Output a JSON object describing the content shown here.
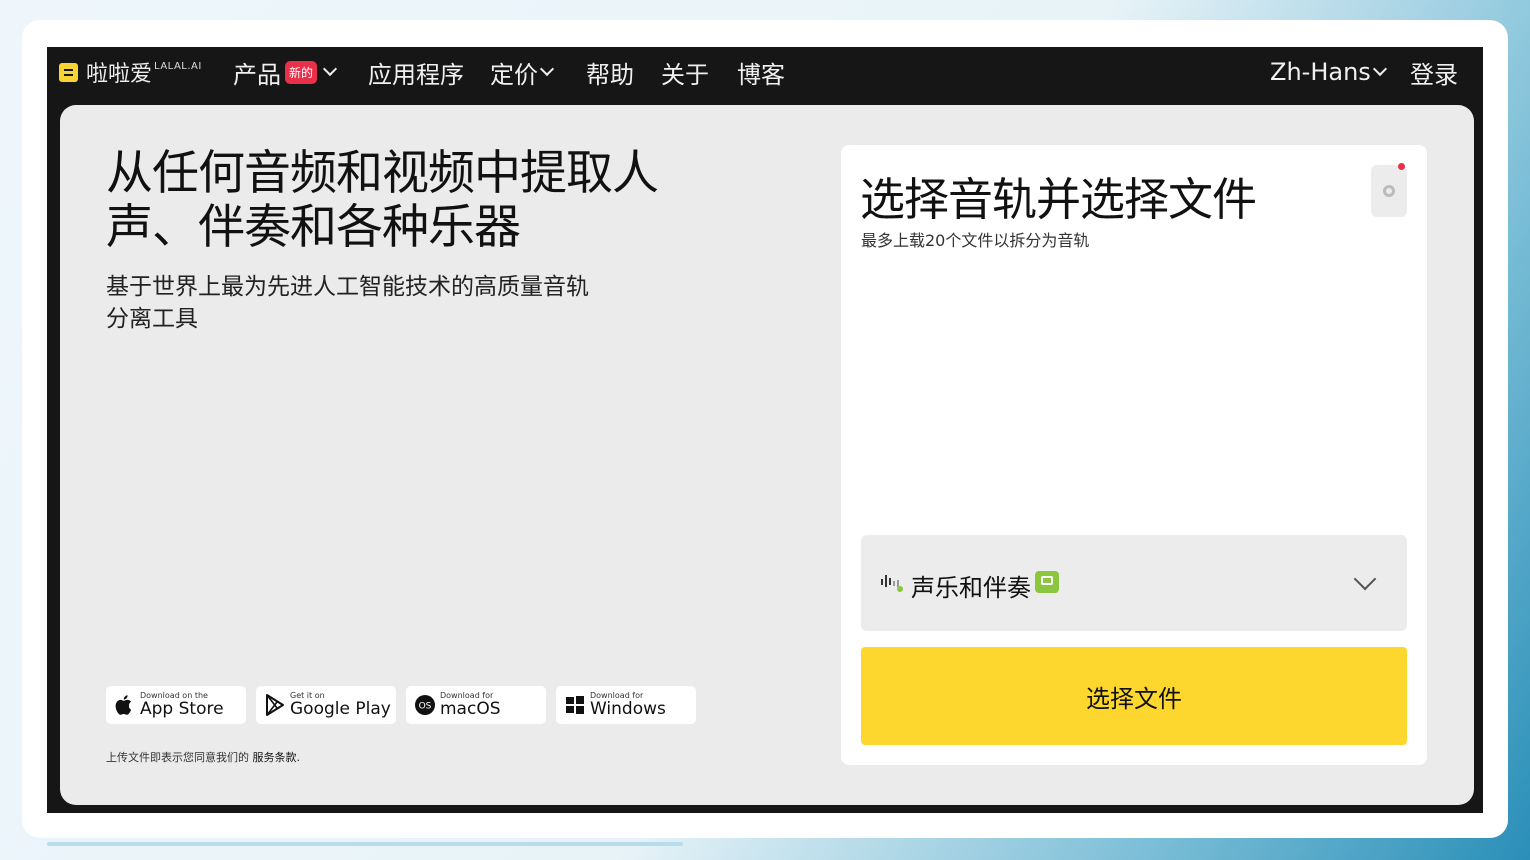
{
  "nav": {
    "logo_text": "啦啦爱",
    "logo_sup": "LALAL.AI",
    "items": [
      {
        "label": "产品",
        "badge": "新的"
      },
      {
        "label": "应用程序"
      },
      {
        "label": "定价"
      },
      {
        "label": "帮助"
      },
      {
        "label": "关于"
      },
      {
        "label": "博客"
      }
    ],
    "language": "Zh-Hans",
    "login": "登录"
  },
  "hero": {
    "title": "从任何音频和视频中提取人声、伴奏和各种乐器",
    "subtitle": "基于世界上最为先进人工智能技术的高质量音轨分离工具"
  },
  "stores": [
    {
      "small": "Download on the",
      "big": "App Store",
      "icon": "apple-icon"
    },
    {
      "small": "Get it on",
      "big": "Google Play",
      "icon": "google-play-icon"
    },
    {
      "small": "Download for",
      "big": "macOS",
      "icon": "macos-icon"
    },
    {
      "small": "Download for",
      "big": "Windows",
      "icon": "windows-icon"
    }
  ],
  "terms": {
    "text": "上传文件即表示您同意我们的 ",
    "link": "服务条款."
  },
  "card": {
    "title": "选择音轨并选择文件",
    "subtitle": "最多上载20个文件以拆分为音轨",
    "stem_select": "声乐和伴奏",
    "cta": "选择文件"
  },
  "colors": {
    "accent_yellow": "#fdd72e",
    "badge_red": "#e8304a",
    "tag_green": "#8cc63f",
    "nav_bg": "#161616"
  }
}
